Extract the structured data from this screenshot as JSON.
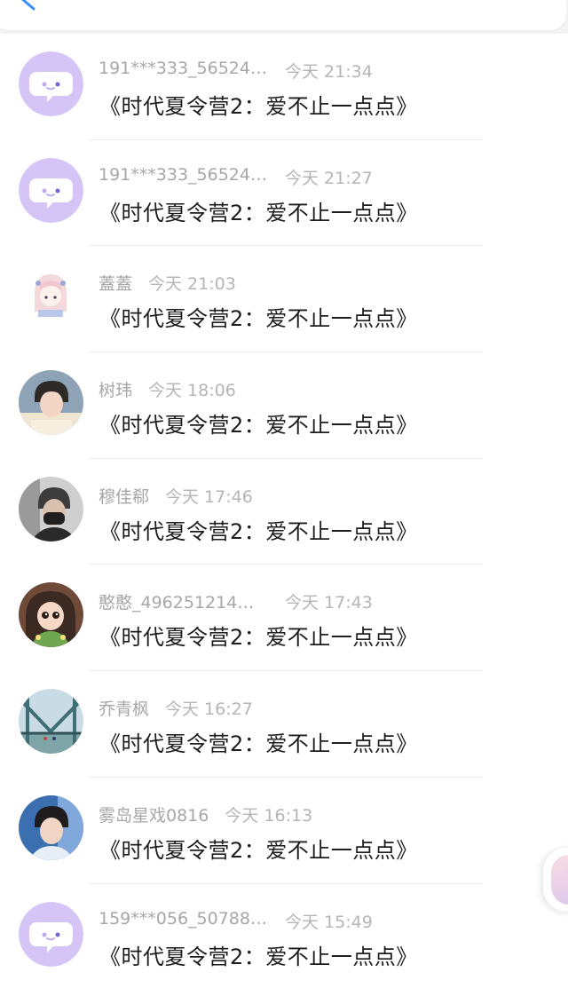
{
  "comments": [
    {
      "user": "191***333_56524…",
      "time": "今天 21:34",
      "content": "《时代夏令营2：爱不止一点点》",
      "avatar": "chat-bubble-icon"
    },
    {
      "user": "191***333_56524…",
      "time": "今天 21:27",
      "content": "《时代夏令营2：爱不止一点点》",
      "avatar": "chat-bubble-icon"
    },
    {
      "user": "蓋蓋",
      "time": "今天 21:03",
      "content": "《时代夏令营2：爱不止一点点》",
      "avatar": "anime-girl"
    },
    {
      "user": "树玮",
      "time": "今天 18:06",
      "content": "《时代夏令营2：爱不止一点点》",
      "avatar": "young-man"
    },
    {
      "user": "穆佳郗",
      "time": "今天 17:46",
      "content": "《时代夏令营2：爱不止一点点》",
      "avatar": "masked-man"
    },
    {
      "user": "憨憨_496251214…",
      "time": "今天 17:43",
      "content": "《时代夏令营2：爱不止一点点》",
      "avatar": "cartoon-girl"
    },
    {
      "user": "乔青枫",
      "time": "今天 16:27",
      "content": "《时代夏令营2：爱不止一点点》",
      "avatar": "bridge-photo"
    },
    {
      "user": "雾岛星戏0816",
      "time": "今天 16:13",
      "content": "《时代夏令营2：爱不止一点点》",
      "avatar": "young-man-blue"
    },
    {
      "user": "159***056_50788…",
      "time": "今天 15:49",
      "content": "《时代夏令营2：爱不止一点点》",
      "avatar": "chat-bubble-icon"
    }
  ],
  "colors": {
    "default_avatar_bg": "#d5c5f6",
    "username": "#a7a7ab",
    "content": "#1d1d1f",
    "accent": "#3d8bff"
  }
}
